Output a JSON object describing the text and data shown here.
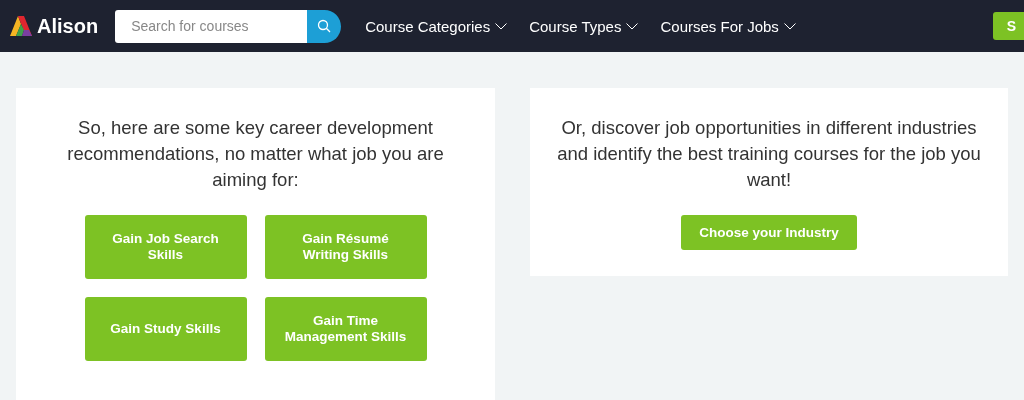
{
  "header": {
    "logo": "Alison",
    "search": {
      "placeholder": "Search for courses"
    },
    "nav": [
      {
        "label": "Course Categories"
      },
      {
        "label": "Course Types"
      },
      {
        "label": "Courses For Jobs"
      }
    ],
    "cta": "S"
  },
  "left_card": {
    "text": "So, here are some key career development recommendations, no matter what job you are aiming for:",
    "buttons": [
      "Gain Job Search Skills",
      "Gain Résumé Writing Skills",
      "Gain Study Skills",
      "Gain Time Management Skills"
    ]
  },
  "right_card": {
    "text": "Or, discover job opportunities in different industries and identify the best training courses for the job you want!",
    "button": "Choose your Industry"
  }
}
